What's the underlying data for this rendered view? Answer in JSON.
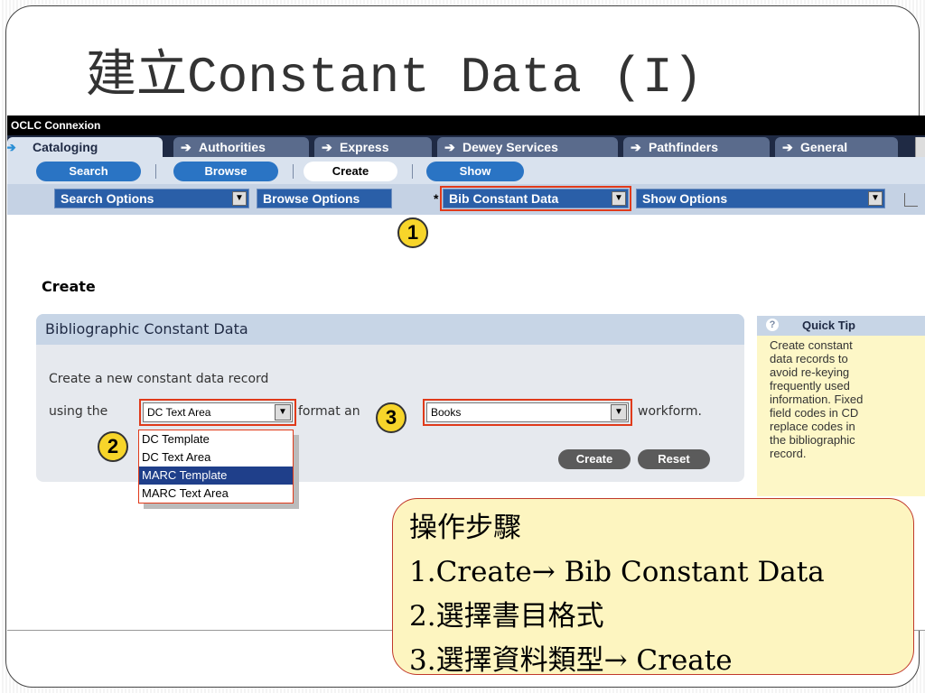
{
  "slide": {
    "title": "建立Constant Data (I)"
  },
  "app": {
    "title": "OCLC Connexion",
    "tabs": [
      {
        "label": "Cataloging",
        "active": true
      },
      {
        "label": "Authorities"
      },
      {
        "label": "Express"
      },
      {
        "label": "Dewey Services"
      },
      {
        "label": "Pathfinders"
      },
      {
        "label": "General"
      }
    ],
    "subnav": [
      {
        "label": "Search"
      },
      {
        "label": "Browse"
      },
      {
        "label": "Create",
        "active": true
      },
      {
        "label": "Show"
      }
    ],
    "options": [
      {
        "label": "Search Options"
      },
      {
        "label": "Browse Options"
      },
      {
        "label": "Bib Constant Data",
        "prefix": "*",
        "highlighted": true
      },
      {
        "label": "Show Options"
      }
    ]
  },
  "page": {
    "heading": "Create",
    "panel_title": "Bibliographic Constant Data",
    "line1": "Create a new constant data record",
    "using_the": "using the",
    "format_text": "format an",
    "workform_text": "workform.",
    "format_select": "DC Text Area",
    "format_options": [
      "DC Template",
      "DC Text Area",
      "MARC Template",
      "MARC Text Area"
    ],
    "format_highlighted": "MARC Template",
    "workform_select": "Books",
    "create_button": "Create",
    "reset_button": "Reset"
  },
  "quick_tip": {
    "title": "Quick Tip",
    "lines": [
      "Create constant",
      "data records to",
      "avoid re-keying",
      "frequently used",
      "information. Fixed",
      "field codes in CD",
      "replace codes in",
      "the bibliographic",
      "record."
    ]
  },
  "badges": [
    "1",
    "2",
    "3"
  ],
  "callout": {
    "lines": [
      "操作步驟",
      "1.Create→ Bib Constant Data",
      "2.選擇書目格式",
      "3.選擇資料類型→ Create"
    ]
  },
  "colors": {
    "highlight_red": "#e03a1a",
    "badge_yellow": "#f7d52a",
    "callout_bg": "#fdf5c0"
  }
}
